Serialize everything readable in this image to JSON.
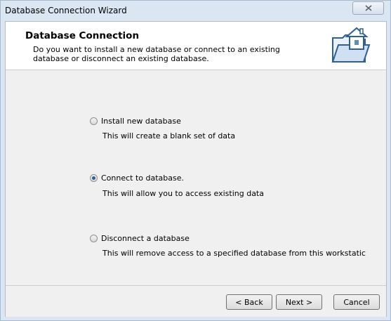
{
  "window": {
    "title": "Database Connection Wizard"
  },
  "header": {
    "title": "Database Connection",
    "description": "Do you want to install a new database or connect to an existing database or disconnect an existing database."
  },
  "options": [
    {
      "label": "Install new database",
      "description": "This will create a blank set of data",
      "selected": false
    },
    {
      "label": "Connect to database.",
      "description": "This will allow you to access existing data",
      "selected": true
    },
    {
      "label": "Disconnect a database",
      "description": "This will remove access to a specified database from this workstatic",
      "selected": false
    }
  ],
  "buttons": {
    "back": "< Back",
    "next": "Next >",
    "cancel": "Cancel"
  },
  "icons": {
    "close": "close-icon",
    "header": "folder-house-icon"
  },
  "colors": {
    "accent": "#2d5f9a",
    "frame": "#dbe6f3"
  }
}
